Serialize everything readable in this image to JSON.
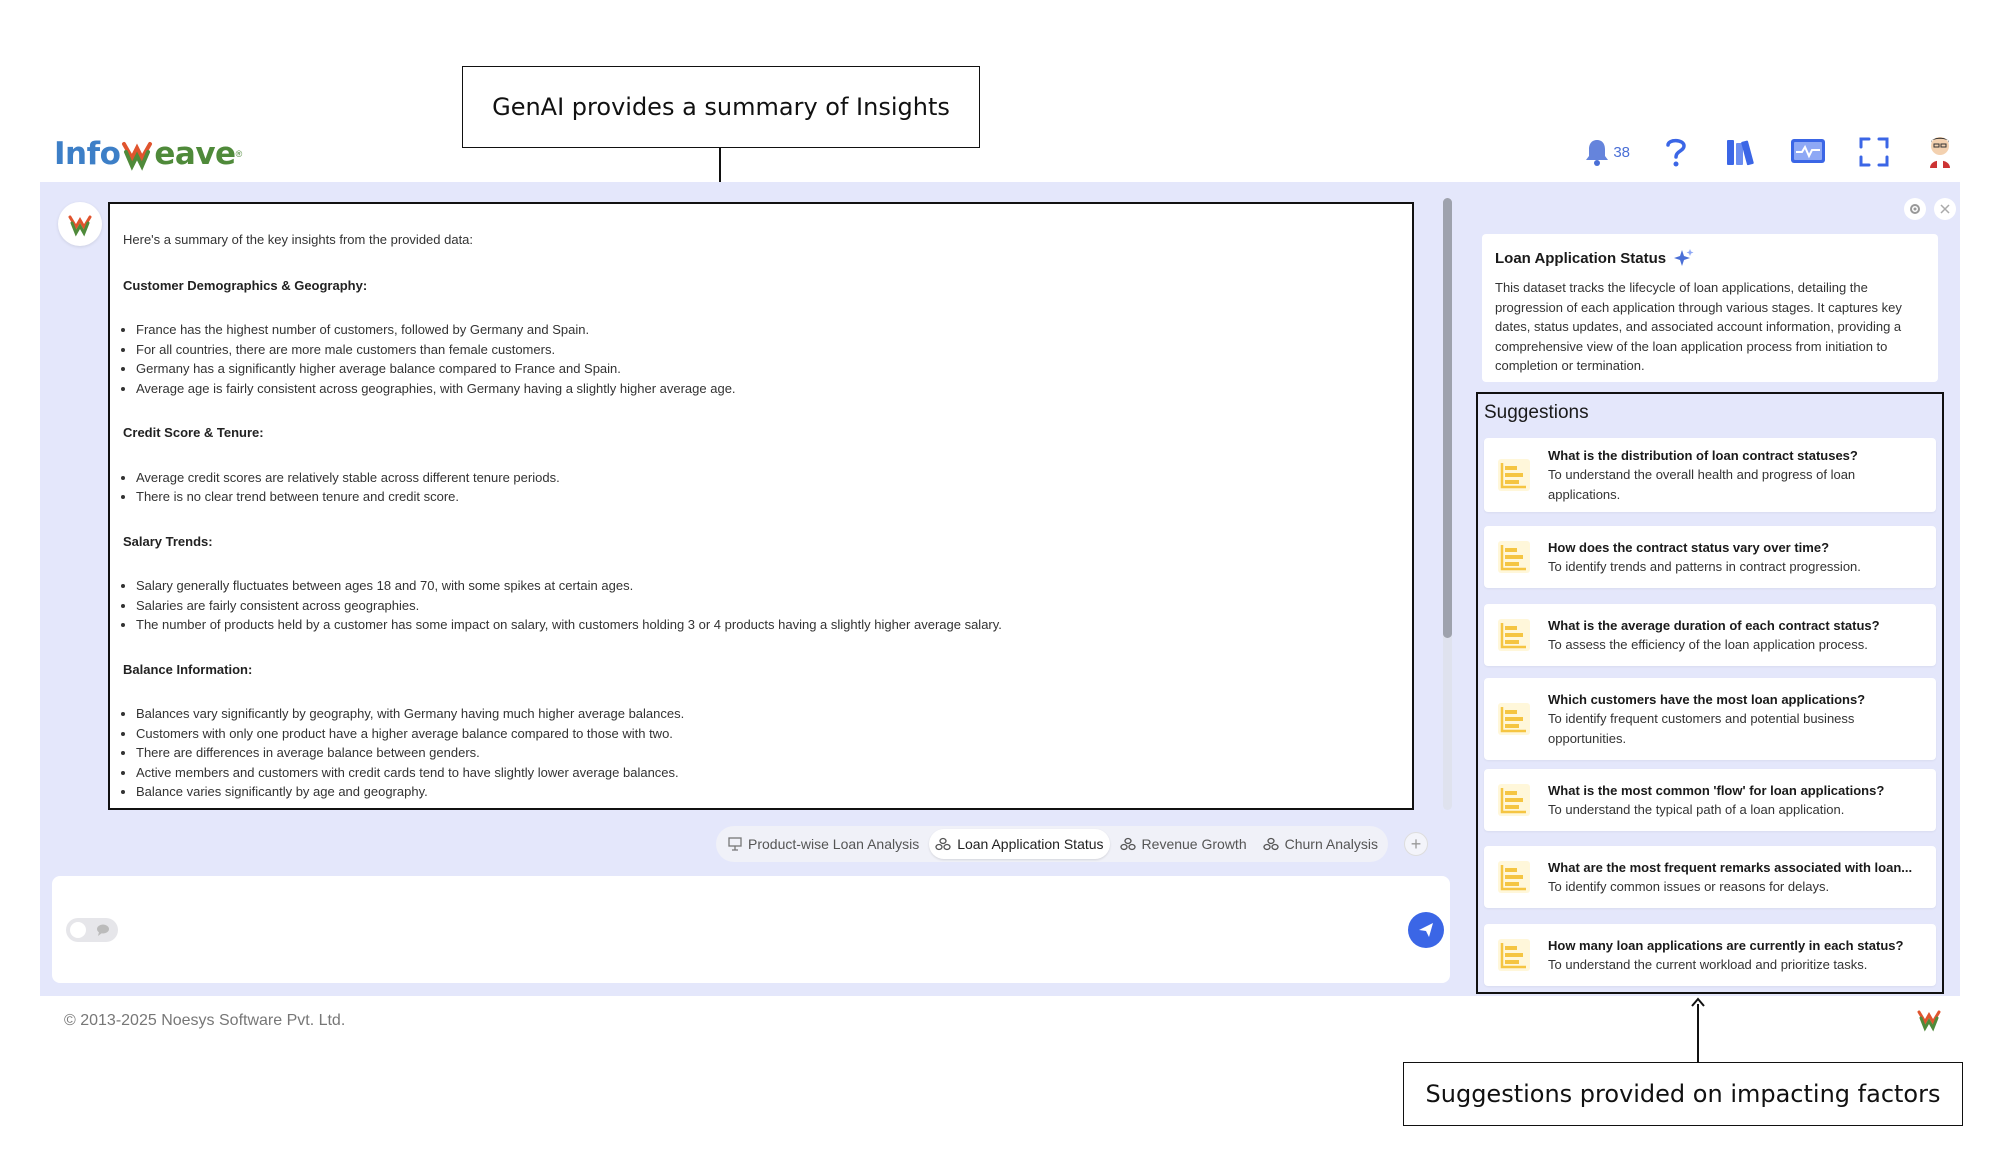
{
  "callouts": {
    "top": "GenAI provides a summary of Insights",
    "bottom": "Suggestions provided on impacting factors"
  },
  "brand": {
    "part1": "Info",
    "part2": "eave",
    "reg": "®"
  },
  "header": {
    "notification_count": "38",
    "icons": [
      "bell-icon",
      "help-icon",
      "library-icon",
      "monitor-icon",
      "fullscreen-icon",
      "user-avatar"
    ]
  },
  "summary": {
    "intro": "Here's a summary of the key insights from the provided data:",
    "sections": [
      {
        "title": "Customer Demographics & Geography:",
        "bullets": [
          "France has the highest number of customers, followed by Germany and Spain.",
          "For all countries, there are more male customers than female customers.",
          "Germany has a significantly higher average balance compared to France and Spain.",
          "Average age is fairly consistent across geographies, with Germany having a slightly higher average age."
        ]
      },
      {
        "title": "Credit Score & Tenure:",
        "bullets": [
          "Average credit scores are relatively stable across different tenure periods.",
          "There is no clear trend between tenure and credit score."
        ]
      },
      {
        "title": "Salary Trends:",
        "bullets": [
          "Salary generally fluctuates between ages 18 and 70, with some spikes at certain ages.",
          "Salaries are fairly consistent across geographies.",
          "The number of products held by a customer has some impact on salary, with customers holding 3 or 4 products having a slightly higher average salary."
        ]
      },
      {
        "title": "Balance Information:",
        "bullets": [
          "Balances vary significantly by geography, with Germany having much higher average balances.",
          "Customers with only one product have a higher average balance compared to those with two.",
          "There are differences in average balance between genders.",
          "Active members and customers with credit cards tend to have slightly lower average balances.",
          "Balance varies significantly by age and geography."
        ]
      }
    ]
  },
  "tabs": [
    {
      "label": "Product-wise Loan Analysis",
      "icon": "presentation-icon",
      "active": false
    },
    {
      "label": "Loan Application Status",
      "icon": "dataset-icon",
      "active": true
    },
    {
      "label": "Revenue Growth",
      "icon": "dataset-icon",
      "active": false
    },
    {
      "label": "Churn Analysis",
      "icon": "dataset-icon",
      "active": false
    }
  ],
  "dataset": {
    "title": "Loan Application Status",
    "description": "This dataset tracks the lifecycle of loan applications, detailing the progression of each application through various stages. It captures key dates, status updates, and associated account information, providing a comprehensive view of the loan application process from initiation to completion or termination."
  },
  "suggestions": {
    "heading": "Suggestions",
    "items": [
      {
        "question": "What is the distribution of loan contract statuses?",
        "detail": "To understand the overall health and progress of loan applications."
      },
      {
        "question": "How does the contract status vary over time?",
        "detail": "To identify trends and patterns in contract progression."
      },
      {
        "question": "What is the average duration of each contract status?",
        "detail": "To assess the efficiency of the loan application process."
      },
      {
        "question": "Which customers have the most loan applications?",
        "detail": "To identify frequent customers and potential business opportunities."
      },
      {
        "question": "What is the most common 'flow' for loan applications?",
        "detail": "To understand the typical path of a loan application."
      },
      {
        "question": "What are the most frequent remarks associated with loan...",
        "detail": "To identify common issues or reasons for delays."
      },
      {
        "question": "How many loan applications are currently in each status?",
        "detail": "To understand the current workload and prioritize tasks."
      }
    ]
  },
  "footer": {
    "copyright": "© 2013-2025 Noesys Software Pvt. Ltd."
  },
  "colors": {
    "accent": "#3b66e6",
    "panel_bg": "#e4e7fb",
    "suggestion_icon": "#f5c542"
  }
}
